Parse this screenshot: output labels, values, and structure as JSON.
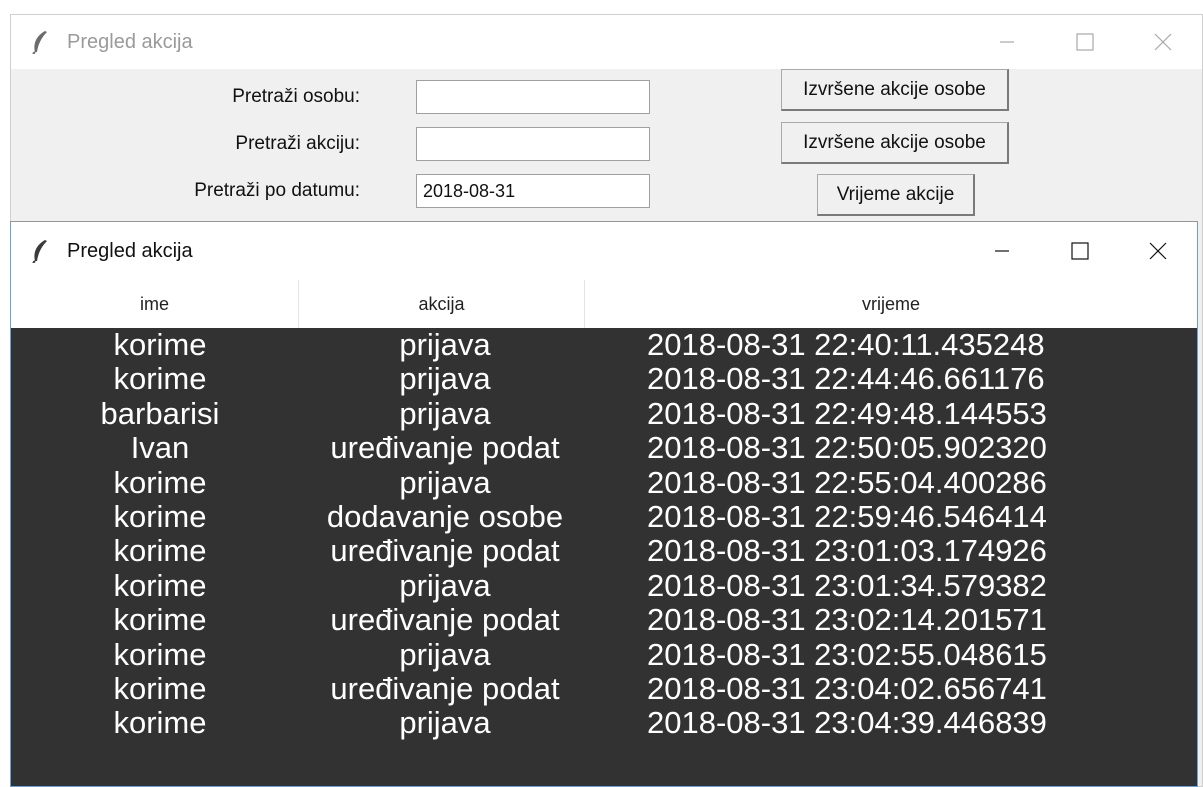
{
  "search_window": {
    "title": "Pregled akcija",
    "fields": [
      {
        "label": "Pretraži osobu:",
        "value": "",
        "button": "Izvršene akcije osobe"
      },
      {
        "label": "Pretraži akciju:",
        "value": "",
        "button": "Izvršene akcije osobe"
      },
      {
        "label": "Pretraži po datumu:",
        "value": "2018-08-31",
        "button": "Vrijeme akcije"
      }
    ]
  },
  "results_window": {
    "title": "Pregled akcija",
    "columns": [
      "ime",
      "akcija",
      "vrijeme"
    ],
    "rows": [
      [
        "korime",
        "prijava",
        "2018-08-31 22:40:11.435248"
      ],
      [
        "korime",
        "prijava",
        "2018-08-31 22:44:46.661176"
      ],
      [
        "barbarisi",
        "prijava",
        "2018-08-31 22:49:48.144553"
      ],
      [
        "Ivan",
        "uređivanje podat",
        "2018-08-31 22:50:05.902320"
      ],
      [
        "korime",
        "prijava",
        "2018-08-31 22:55:04.400286"
      ],
      [
        "korime",
        "dodavanje osobe",
        "2018-08-31 22:59:46.546414"
      ],
      [
        "korime",
        "uređivanje podat",
        "2018-08-31 23:01:03.174926"
      ],
      [
        "korime",
        "prijava",
        "2018-08-31 23:01:34.579382"
      ],
      [
        "korime",
        "uređivanje podat",
        "2018-08-31 23:02:14.201571"
      ],
      [
        "korime",
        "prijava",
        "2018-08-31 23:02:55.048615"
      ],
      [
        "korime",
        "uređivanje podat",
        "2018-08-31 23:04:02.656741"
      ],
      [
        "korime",
        "prijava",
        "2018-08-31 23:04:39.446839"
      ]
    ]
  },
  "icons": {
    "app": "feather-icon",
    "minimize": "minimize-icon",
    "maximize": "maximize-icon",
    "close": "close-icon"
  },
  "colors": {
    "grid_background": "#323232",
    "grid_text": "#ffffff",
    "window_background": "#f0f0f0",
    "active_border": "#6aa0d4"
  }
}
